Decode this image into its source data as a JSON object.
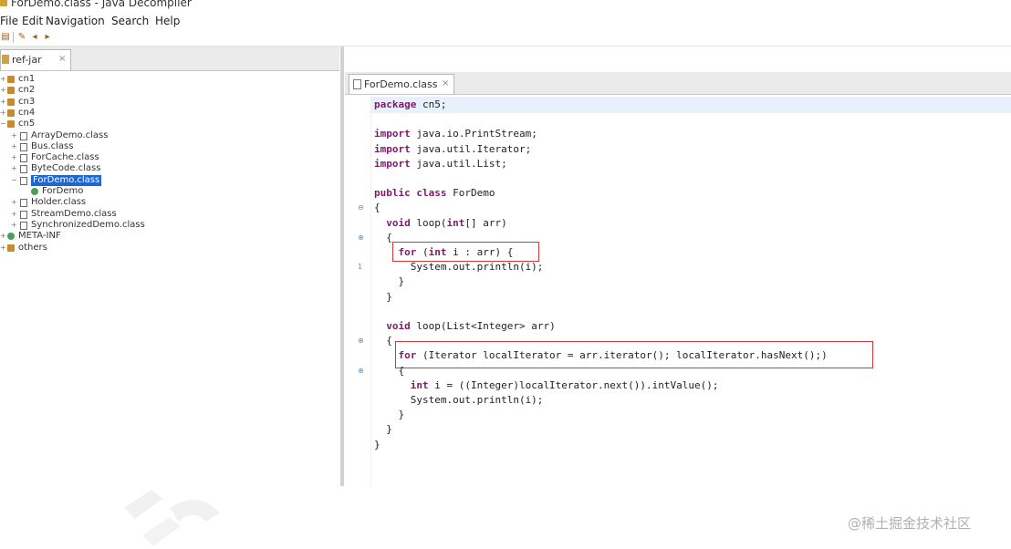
{
  "window": {
    "title": "ForDemo.class - Java Decompiler"
  },
  "menu": [
    "File",
    "Edit",
    "Navigation",
    "Search",
    "Help"
  ],
  "toolbar": {
    "icons": [
      "open-file-icon",
      "open-recent-icon",
      "back-icon",
      "forward-icon"
    ]
  },
  "left_panel": {
    "tab": {
      "label": "ref-jar",
      "close": "×"
    },
    "tree": [
      {
        "label": "cn1",
        "icon": "package-icon",
        "expander": "+",
        "level": 0,
        "selected": false
      },
      {
        "label": "cn2",
        "icon": "package-icon",
        "expander": "+",
        "level": 0,
        "selected": false
      },
      {
        "label": "cn3",
        "icon": "package-icon",
        "expander": "+",
        "level": 0,
        "selected": false
      },
      {
        "label": "cn4",
        "icon": "package-icon",
        "expander": "+",
        "level": 0,
        "selected": false
      },
      {
        "label": "cn5",
        "icon": "package-icon",
        "expander": "−",
        "level": 0,
        "selected": false
      },
      {
        "label": "ArrayDemo.class",
        "icon": "class-file-icon",
        "expander": "+",
        "level": 1,
        "selected": false
      },
      {
        "label": "Bus.class",
        "icon": "class-file-icon",
        "expander": "+",
        "level": 1,
        "selected": false
      },
      {
        "label": "ForCache.class",
        "icon": "class-file-icon",
        "expander": "+",
        "level": 1,
        "selected": false
      },
      {
        "label": "ByteCode.class",
        "icon": "class-file-icon",
        "expander": "+",
        "level": 1,
        "selected": false
      },
      {
        "label": "ForDemo.class",
        "icon": "class-file-icon",
        "expander": "−",
        "level": 1,
        "selected": true
      },
      {
        "label": "ForDemo",
        "icon": "class-icon",
        "expander": "",
        "level": 2,
        "selected": false
      },
      {
        "label": "Holder.class",
        "icon": "class-file-icon",
        "expander": "+",
        "level": 1,
        "selected": false
      },
      {
        "label": "StreamDemo.class",
        "icon": "class-file-icon",
        "expander": "+",
        "level": 1,
        "selected": false
      },
      {
        "label": "SynchronizedDemo.class",
        "icon": "class-file-icon",
        "expander": "+",
        "level": 1,
        "selected": false
      },
      {
        "label": "META-INF",
        "icon": "folder-icon",
        "expander": "+",
        "level": 0,
        "selected": false
      },
      {
        "label": "others",
        "icon": "package-icon",
        "expander": "+",
        "level": 0,
        "selected": false
      }
    ]
  },
  "editor": {
    "tab": {
      "label": "ForDemo.class",
      "close": "×"
    },
    "lines": [
      [
        {
          "t": "package",
          "k": 1
        },
        {
          "t": " cn5;"
        }
      ],
      [],
      [
        {
          "t": "import",
          "k": 1
        },
        {
          "t": " java.io.PrintStream;"
        }
      ],
      [
        {
          "t": "import",
          "k": 1
        },
        {
          "t": " java.util.Iterator;"
        }
      ],
      [
        {
          "t": "import",
          "k": 1
        },
        {
          "t": " java.util.List;"
        }
      ],
      [],
      [
        {
          "t": "public class",
          "k": 1
        },
        {
          "t": " ForDemo"
        }
      ],
      [
        {
          "t": "{"
        }
      ],
      [
        {
          "t": "  void",
          "k": 1
        },
        {
          "t": " loop("
        },
        {
          "t": "int",
          "k": 1
        },
        {
          "t": "[] arr)"
        }
      ],
      [
        {
          "t": "  {"
        }
      ],
      [
        {
          "t": "    for",
          "k": 1
        },
        {
          "t": " ("
        },
        {
          "t": "int",
          "k": 1
        },
        {
          "t": " i : arr) {"
        }
      ],
      [
        {
          "t": "      System.out.println(i);"
        }
      ],
      [
        {
          "t": "    }"
        }
      ],
      [
        {
          "t": "  }"
        }
      ],
      [],
      [
        {
          "t": "  void",
          "k": 1
        },
        {
          "t": " loop(List<Integer> arr)"
        }
      ],
      [
        {
          "t": "  {"
        }
      ],
      [
        {
          "t": "    for",
          "k": 1
        },
        {
          "t": " (Iterator localIterator = arr.iterator(); localIterator.hasNext();)"
        }
      ],
      [
        {
          "t": "    {"
        }
      ],
      [
        {
          "t": "      int",
          "k": 1
        },
        {
          "t": " i = ((Integer)localIterator.next()).intValue();"
        }
      ],
      [
        {
          "t": "      System.out.println(i);"
        }
      ],
      [
        {
          "t": "    }"
        }
      ],
      [
        {
          "t": "  }"
        }
      ],
      [
        {
          "t": "}"
        }
      ]
    ],
    "gutter_marks": [
      "",
      "",
      "",
      "",
      "",
      "",
      "",
      "⊖",
      "",
      "⊕",
      "",
      "1",
      "",
      "",
      "",
      "",
      "⊕",
      "",
      "⊕",
      "",
      "",
      "",
      "",
      ""
    ]
  },
  "watermark": "@稀土掘金技术社区"
}
